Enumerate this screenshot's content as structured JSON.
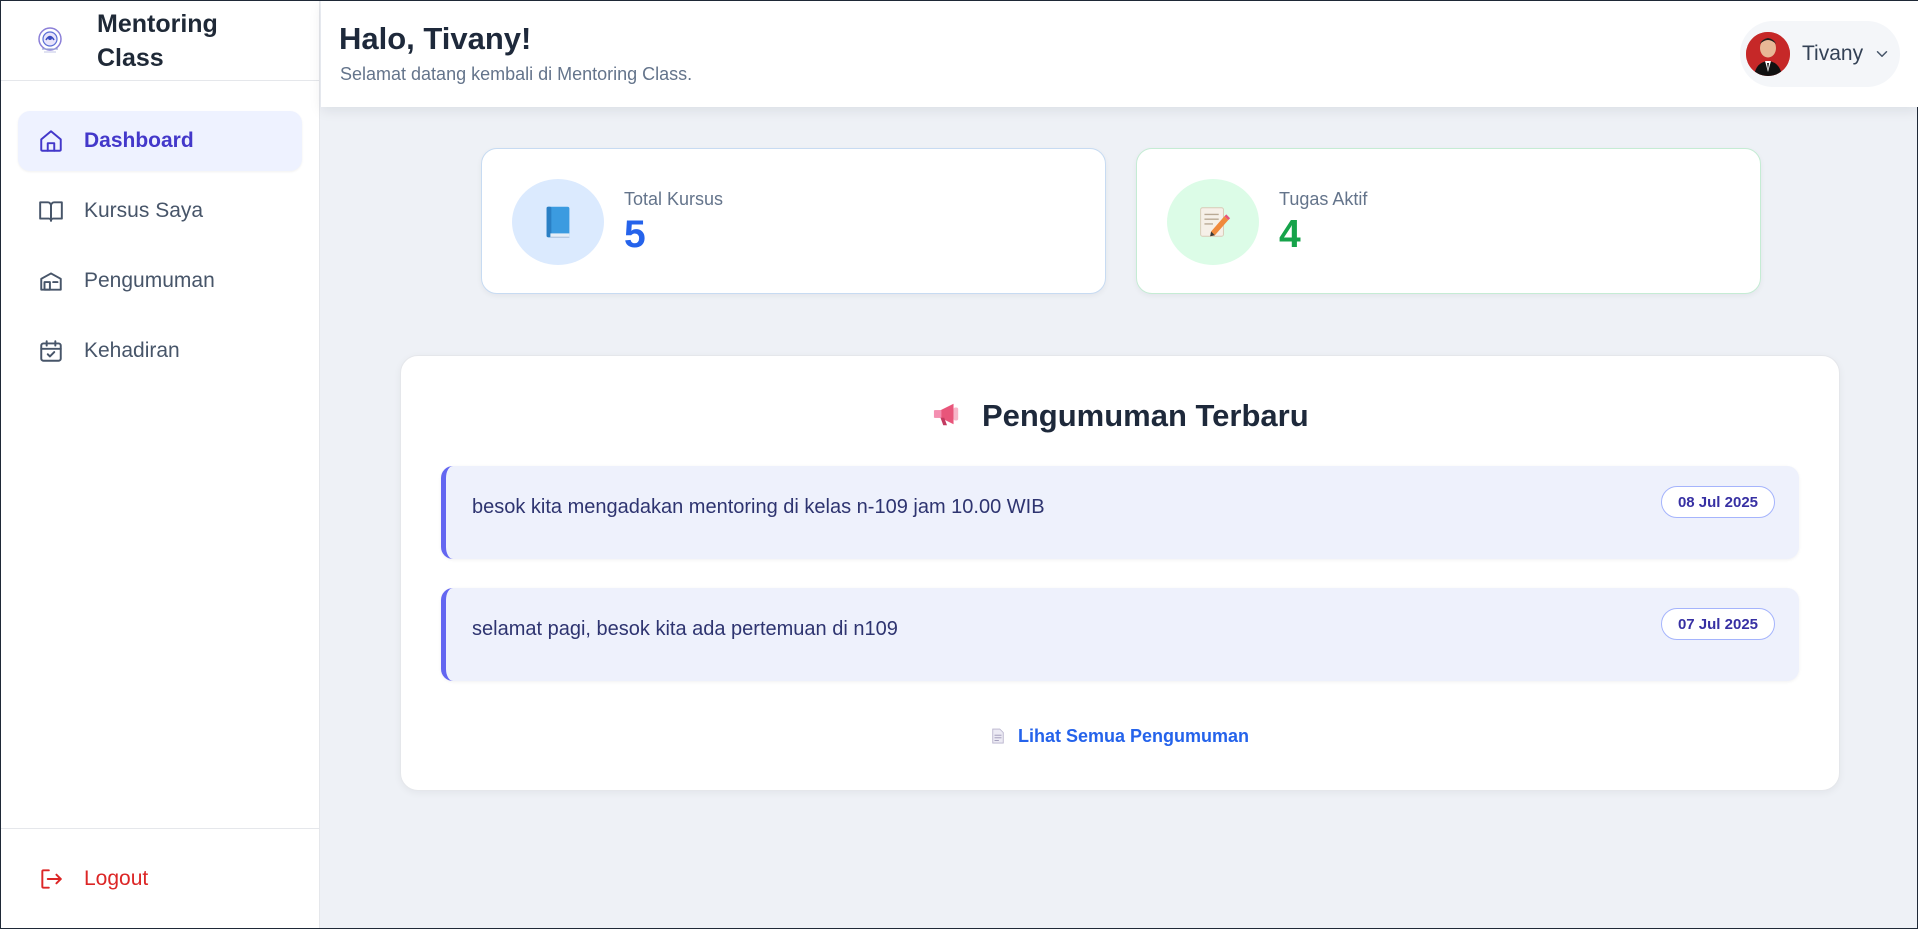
{
  "brand": {
    "name": "Mentoring Class"
  },
  "sidebar": {
    "items": [
      {
        "label": "Dashboard",
        "icon": "home-icon",
        "active": true
      },
      {
        "label": "Kursus Saya",
        "icon": "book-open-icon",
        "active": false
      },
      {
        "label": "Pengumuman",
        "icon": "announcement-icon",
        "active": false
      },
      {
        "label": "Kehadiran",
        "icon": "calendar-check-icon",
        "active": false
      }
    ],
    "logout_label": "Logout"
  },
  "header": {
    "greeting": "Halo, Tivany!",
    "subtitle": "Selamat datang kembali di Mentoring Class.",
    "user_name": "Tivany"
  },
  "stats": [
    {
      "label": "Total Kursus",
      "value": "5",
      "icon": "blue-book-icon",
      "color": "#2563eb"
    },
    {
      "label": "Tugas Aktif",
      "value": "4",
      "icon": "memo-pencil-icon",
      "color": "#16a34a"
    }
  ],
  "announcements": {
    "title": "Pengumuman Terbaru",
    "items": [
      {
        "text": "besok kita mengadakan mentoring di kelas n-109 jam 10.00 WIB",
        "date": "08 Jul 2025"
      },
      {
        "text": "selamat pagi, besok kita ada pertemuan di n109",
        "date": "07 Jul 2025"
      }
    ],
    "view_all_label": "Lihat Semua Pengumuman"
  },
  "colors": {
    "accent": "#4338ca",
    "active_bg": "#eef2ff",
    "logout": "#dc2626",
    "link": "#2563eb"
  }
}
